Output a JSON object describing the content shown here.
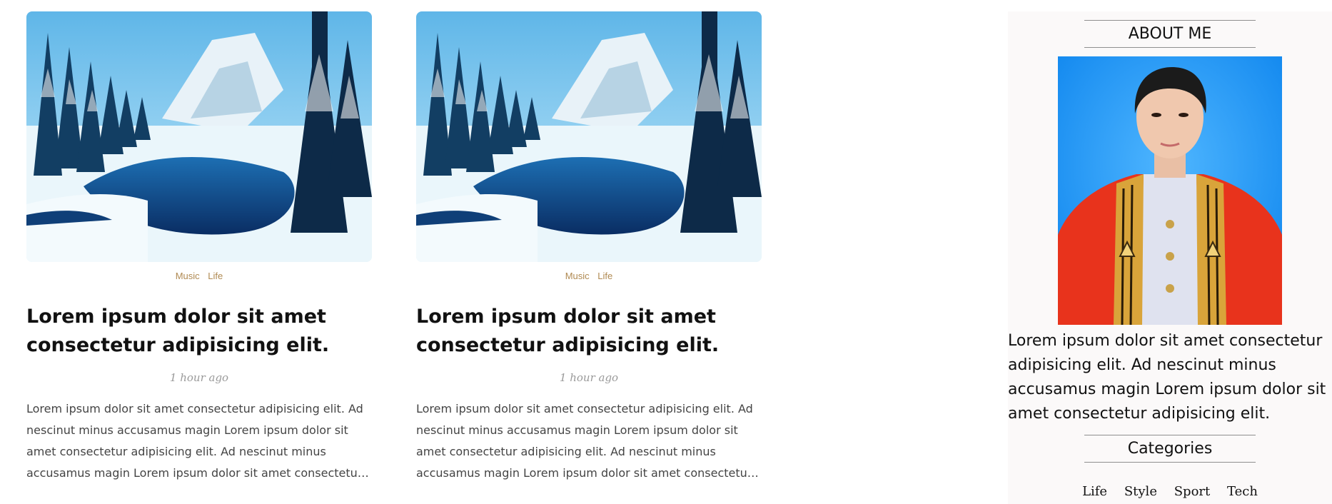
{
  "posts": [
    {
      "tags": [
        "Music",
        "Life"
      ],
      "title": "Lorem ipsum dolor sit amet consectetur adipisicing elit.",
      "time": "1 hour ago",
      "excerpt": "Lorem ipsum dolor sit amet consectetur adipisicing elit. Ad nescinut minus accusamus magin Lorem ipsum dolor sit amet consectetur adipisicing elit. Ad nescinut minus accusamus magin Lorem ipsum dolor sit amet consectetur adipisicing elit. Ad nescinut minus accusamus magin"
    },
    {
      "tags": [
        "Music",
        "Life"
      ],
      "title": "Lorem ipsum dolor sit amet consectetur adipisicing elit.",
      "time": "1 hour ago",
      "excerpt": "Lorem ipsum dolor sit amet consectetur adipisicing elit. Ad nescinut minus accusamus magin Lorem ipsum dolor sit amet consectetur adipisicing elit. Ad nescinut minus accusamus magin Lorem ipsum dolor sit amet consectetur adipisicing elit. Ad nescinut minus accusamus magin"
    }
  ],
  "sidebar": {
    "about_heading": "ABOUT ME",
    "about_text": "Lorem ipsum dolor sit amet consectetur adipisicing elit. Ad nescinut minus accusamus magin Lorem ipsum dolor sit amet consectetur adipisicing elit.",
    "categories_heading": "Categories",
    "categories": [
      "Life",
      "Style",
      "Sport",
      "Tech"
    ]
  },
  "colors": {
    "tag": "#b08a52",
    "time": "#9a9a9a",
    "sidebar_bg": "#fbf9f9",
    "photo_bg": "#1a8ff0",
    "gown_red": "#e8331c",
    "sash_gold": "#d9a43a"
  }
}
